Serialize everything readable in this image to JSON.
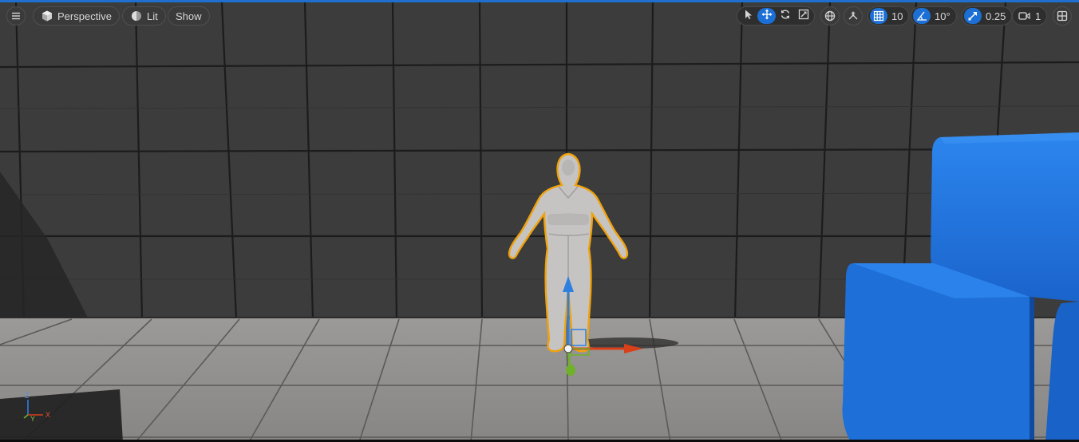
{
  "toolbar": {
    "menu_icon": "hamburger-icon",
    "view_mode_label": "Perspective",
    "view_mode_icon": "cube-icon",
    "lighting_label": "Lit",
    "lighting_icon": "sphere-icon",
    "show_label": "Show"
  },
  "transform_tools": {
    "select_icon": "cursor-icon",
    "translate_icon": "move-icon",
    "rotate_icon": "rotate-icon",
    "scale_icon": "scale-icon",
    "active": "translate"
  },
  "coordinate_space_icon": "globe-icon",
  "surface_snap_icon": "surface-snap-icon",
  "snapping": {
    "grid_value": "10",
    "grid_icon": "grid-icon",
    "rotation_value": "10°",
    "rotation_icon": "angle-icon",
    "scale_value": "0.25",
    "scale_icon": "scale-arrow-icon"
  },
  "camera": {
    "speed_value": "1",
    "icon": "camera-icon"
  },
  "layout_icon": "viewport-layout-icon",
  "axis_labels": {
    "z": "Z",
    "y": "Y",
    "x": "X"
  },
  "colors": {
    "accent": "#1c6fd4",
    "selection_outline": "#f0a20c",
    "gizmo_x": "#d8401a",
    "gizmo_y": "#6fb12a",
    "gizmo_z": "#2f7fe0",
    "cubes": "#1e6fd8"
  }
}
